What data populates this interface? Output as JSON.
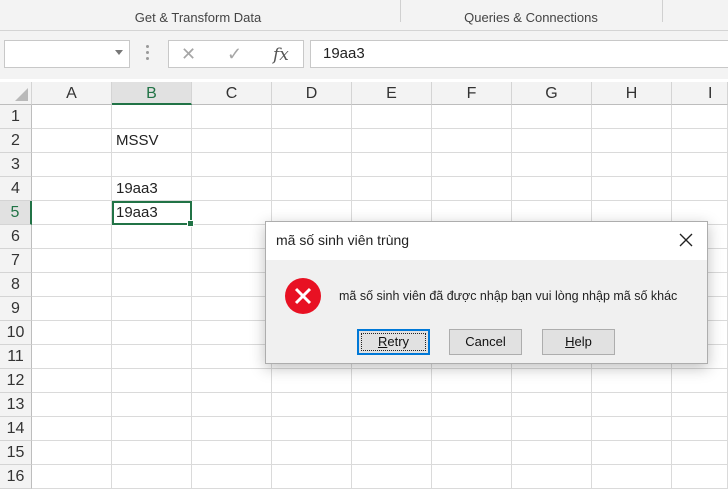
{
  "ribbon": {
    "groups": [
      "Get & Transform Data",
      "Queries & Connections"
    ]
  },
  "formula_bar": {
    "name_box_value": "",
    "cancel_icon": "✕",
    "enter_icon": "✓",
    "fx_label": "fx",
    "content": "19aa3"
  },
  "sheet": {
    "columns": [
      "A",
      "B",
      "C",
      "D",
      "E",
      "F",
      "G",
      "H",
      "I"
    ],
    "rows": [
      "1",
      "2",
      "3",
      "4",
      "5",
      "6",
      "7",
      "8",
      "9",
      "10",
      "11",
      "12",
      "13",
      "14",
      "15",
      "16"
    ],
    "selected_column": "B",
    "selected_row": "5",
    "cells": {
      "B2": "MSSV",
      "B4": "19aa3",
      "B5": "19aa3"
    }
  },
  "dialog": {
    "title": "mã số sinh viên trùng",
    "message": "mã số sinh viên đã được nhập bạn vui lòng nhập mã số khác",
    "icon": "error-icon",
    "buttons": {
      "retry_mnemonic": "R",
      "retry_rest": "etry",
      "cancel": "Cancel",
      "help_mnemonic": "H",
      "help_rest": "elp"
    }
  },
  "colors": {
    "selection_accent": "#217346",
    "error_red": "#e81123",
    "default_button_border": "#0078d7"
  }
}
